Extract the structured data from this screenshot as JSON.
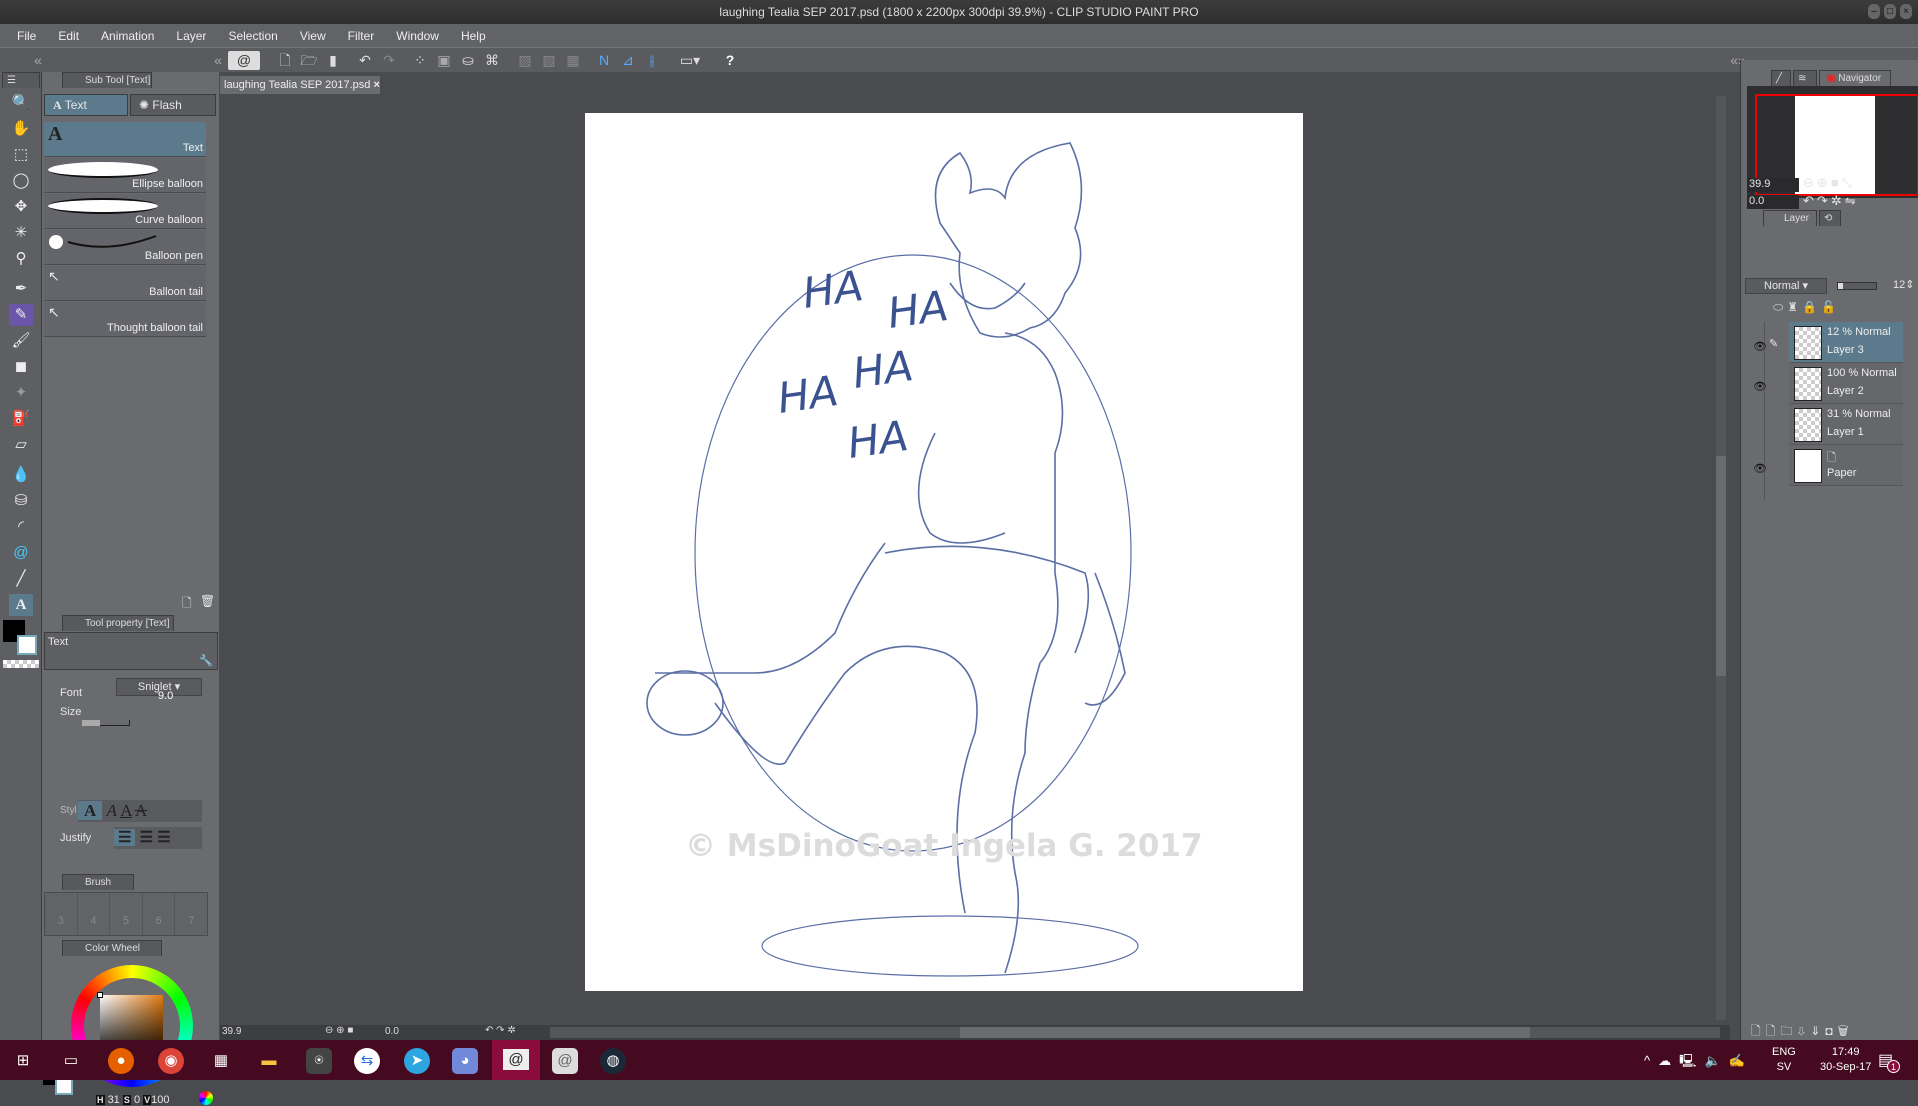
{
  "window": {
    "title": "laughing Tealia SEP 2017.psd (1800 x 2200px 300dpi 39.9%) - CLIP STUDIO PAINT PRO"
  },
  "menu": [
    "File",
    "Edit",
    "Animation",
    "Layer",
    "Selection",
    "View",
    "Filter",
    "Window",
    "Help"
  ],
  "document_tab": "laughing Tealia SEP 2017.psd",
  "subtool": {
    "panel_title": "Sub Tool [Text]",
    "groups": [
      "Text",
      "Flash"
    ],
    "items": [
      "Text",
      "Ellipse balloon",
      "Curve balloon",
      "Balloon pen",
      "Balloon tail",
      "Thought balloon tail"
    ]
  },
  "tool_property": {
    "panel_title": "Tool property [Text]",
    "tool_name": "Text",
    "font_label": "Font",
    "font_value": "Sniglet",
    "size_label": "Size",
    "size_value": "9.0",
    "style_label": "Styl",
    "justify_label": "Justify"
  },
  "brush_size": {
    "panel_title": "Brush Size",
    "sizes": [
      "3",
      "4",
      "5",
      "6",
      "7"
    ]
  },
  "color_wheel": {
    "panel_title": "Color Wheel",
    "h_label": "H",
    "h": "31",
    "s_label": "S",
    "s": "0",
    "v_label": "V",
    "v": "100"
  },
  "navigator": {
    "tab": "Navigator",
    "zoom": "39.9",
    "rotation": "0.0"
  },
  "layer_panel": {
    "tab": "Layer",
    "blend_mode": "Normal",
    "opacity": "12",
    "layers": [
      {
        "info": "12 % Normal",
        "name": "Layer 3",
        "visible": true,
        "selected": true
      },
      {
        "info": "100 % Normal",
        "name": "Layer 2",
        "visible": true
      },
      {
        "info": "31 % Normal",
        "name": "Layer 1",
        "visible": false
      },
      {
        "info": "",
        "name": "Paper",
        "visible": true
      }
    ]
  },
  "canvas": {
    "ha_texts": [
      "HA",
      "HA",
      "HA",
      "HA",
      "HA"
    ],
    "watermark": "© MsDinoGoat Ingela G. 2017",
    "line_color": "#4a5f9a"
  },
  "statusbar": {
    "zoom": "39.9",
    "rotation": "0.0"
  },
  "taskbar": {
    "lang1": "ENG",
    "lang2": "SV",
    "time": "17:49",
    "date": "30-Sep-17",
    "notifications": "1"
  }
}
